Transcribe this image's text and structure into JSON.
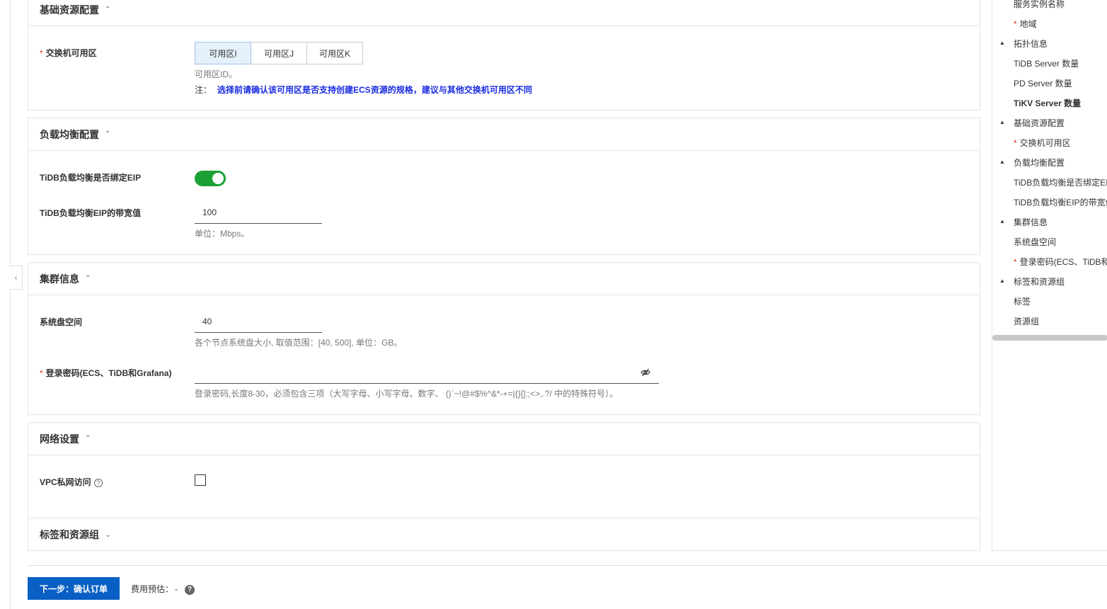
{
  "sections": {
    "basic": {
      "title": "基础资源配置",
      "zone_label": "交换机可用区",
      "zones": [
        "可用区I",
        "可用区J",
        "可用区K"
      ],
      "selected_zone": "可用区I",
      "zone_help": "可用区ID。",
      "note_label": "注：",
      "note_text": "选择前请确认该可用区是否支持创建ECS资源的规格，建议与其他交换机可用区不同"
    },
    "lb": {
      "title": "负载均衡配置",
      "eip_label": "TiDB负载均衡是否绑定EIP",
      "eip_enabled": true,
      "bw_label": "TiDB负载均衡EIP的带宽值",
      "bw_value": "100",
      "bw_help": "单位：Mbps。"
    },
    "cluster": {
      "title": "集群信息",
      "disk_label": "系统盘空间",
      "disk_value": "40",
      "disk_help": "各个节点系统盘大小, 取值范围：[40, 500], 单位：GB。",
      "pwd_label": "登录密码(ECS、TiDB和Grafana)",
      "pwd_value": "",
      "pwd_help": "登录密码,长度8-30，必须包含三项（大写字母、小写字母、数字、 ()`~!@#$%^&*-+=|{}[]:;<>,.?/ 中的特殊符号）。"
    },
    "network": {
      "title": "网络设置",
      "vpc_label": "VPC私网访问",
      "vpc_checked": false
    },
    "tags": {
      "title": "标签和资源组"
    }
  },
  "required_mark": "*",
  "footer": {
    "next_label": "下一步：确认订单",
    "fee_label": "费用预估：",
    "fee_value": "-"
  },
  "toc": [
    {
      "label": "服务实例名称",
      "type": "sub",
      "required": false
    },
    {
      "label": "地域",
      "type": "sub",
      "required": true
    },
    {
      "label": "拓扑信息",
      "type": "group"
    },
    {
      "label": "TiDB Server 数量",
      "type": "sub",
      "required": false
    },
    {
      "label": "PD Server 数量",
      "type": "sub",
      "required": false
    },
    {
      "label": "TiKV Server 数量",
      "type": "sub",
      "required": false,
      "active": true
    },
    {
      "label": "基础资源配置",
      "type": "group"
    },
    {
      "label": "交换机可用区",
      "type": "sub",
      "required": true
    },
    {
      "label": "负载均衡配置",
      "type": "group"
    },
    {
      "label": "TiDB负载均衡是否绑定EIP",
      "type": "sub",
      "required": false
    },
    {
      "label": "TiDB负载均衡EIP的带宽值",
      "type": "sub",
      "required": false
    },
    {
      "label": "集群信息",
      "type": "group"
    },
    {
      "label": "系统盘空间",
      "type": "sub",
      "required": false
    },
    {
      "label": "登录密码(ECS、TiDB和Grafana)",
      "type": "sub",
      "required": true
    },
    {
      "label": "标签和资源组",
      "type": "group"
    },
    {
      "label": "标签",
      "type": "sub",
      "required": false
    },
    {
      "label": "资源组",
      "type": "sub",
      "required": false
    }
  ],
  "colors": {
    "primary": "#0a5fc4",
    "toggle_on": "#1ba035",
    "note": "#1a2be0",
    "required": "#d93026"
  }
}
